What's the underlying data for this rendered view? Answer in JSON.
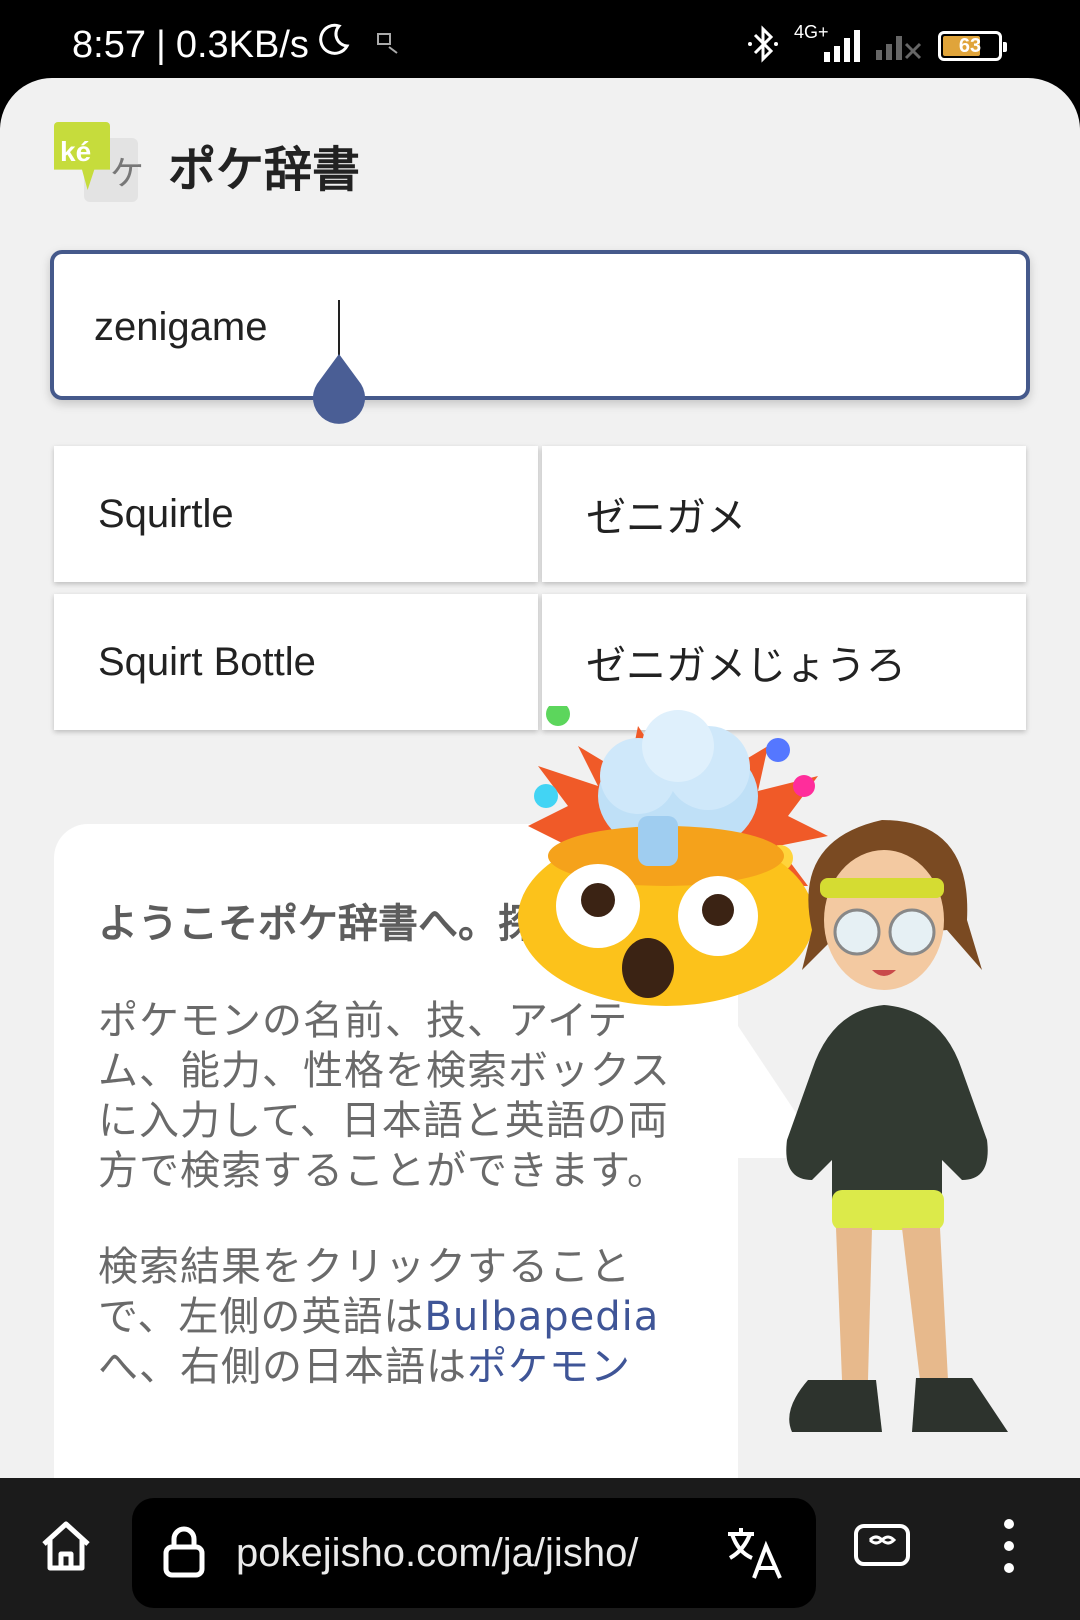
{
  "status_bar": {
    "time": "8:57",
    "speed": "0.3KB/s",
    "network": "4G+",
    "battery": "63",
    "battery_level": 0.63
  },
  "header": {
    "logo_text": "ké",
    "logo_kana": "ケ",
    "title": "ポケ辞書"
  },
  "search": {
    "value": "zenigame"
  },
  "results": [
    {
      "english": "Squirtle",
      "japanese": "ゼニガメ"
    },
    {
      "english": "Squirt Bottle",
      "japanese": "ゼニガメじょうろ"
    }
  ],
  "welcome": {
    "heading": "ようこそポケ辞書へ。探見です。",
    "paragraph1": "ポケモンの名前、技、アイテム、能力、性格を検索ボックスに入力して、日本語と英語の両方で検索することができます。",
    "paragraph2_start": "検索結果をクリックすることで、左側の英語は",
    "paragraph2_link1": "Bulbapedia",
    "paragraph2_mid": "へ、右側の日本語は",
    "paragraph2_link2": "ポケモン"
  },
  "browser": {
    "url": "pokejisho.com/ja/jisho/"
  },
  "icons": [
    "moon-icon",
    "bluetooth-icon",
    "signal-icon",
    "battery-icon",
    "home-icon",
    "lock-icon",
    "translate-icon",
    "tabs-icon",
    "more-icon",
    "mind-blown-emoji",
    "character-illustration"
  ]
}
